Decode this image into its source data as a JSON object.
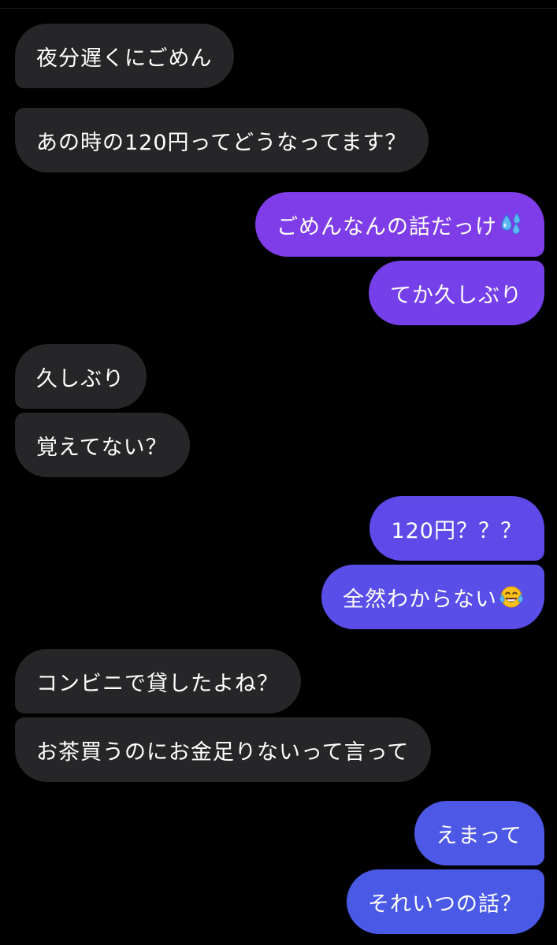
{
  "conversation": {
    "messages": [
      {
        "side": "received",
        "text": "夜分遅くにごめん"
      },
      {
        "side": "received",
        "text": "あの時の120円ってどうなってます？"
      },
      {
        "side": "sent",
        "text": "ごめんなんの話だっけ",
        "emoji": "sweat-droplets-icon"
      },
      {
        "side": "sent",
        "text": "てか久しぶり"
      },
      {
        "side": "received",
        "text": "久しぶり"
      },
      {
        "side": "received",
        "text": "覚えてない？"
      },
      {
        "side": "sent",
        "text": "120円？？？"
      },
      {
        "side": "sent",
        "text": "全然わからない",
        "emoji": "tears-of-joy-icon"
      },
      {
        "side": "received",
        "text": "コンビニで貸したよね？"
      },
      {
        "side": "received",
        "text": "お茶買うのにお金足りないって言って"
      },
      {
        "side": "sent",
        "text": "えまって"
      },
      {
        "side": "sent",
        "text": "それいつの話？"
      }
    ]
  },
  "colors": {
    "background": "#000000",
    "received_bubble": "#262628",
    "sent_gradient_top": "#8a3ee6",
    "sent_gradient_bottom": "#4c5ae6",
    "text": "#ffffff"
  }
}
